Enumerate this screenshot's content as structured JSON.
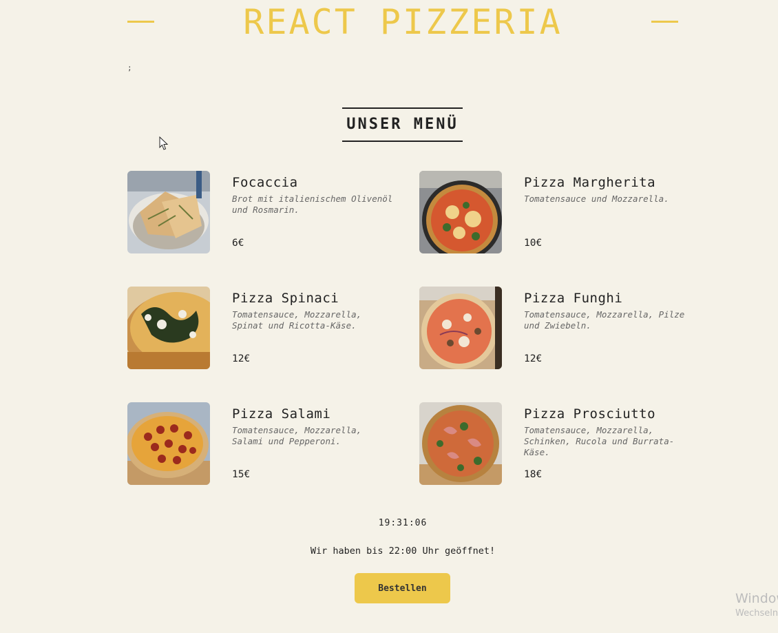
{
  "header": {
    "title": "REACT PIZZERIA"
  },
  "stray_text": ";",
  "menu": {
    "heading": "UNSER MENÜ",
    "items": [
      {
        "name": "Focaccia",
        "ingredients": "Brot mit italienischem Olivenöl und Rosmarin.",
        "price": "6€"
      },
      {
        "name": "Pizza Margherita",
        "ingredients": "Tomatensauce und Mozzarella.",
        "price": "10€"
      },
      {
        "name": "Pizza Spinaci",
        "ingredients": "Tomatensauce, Mozzarella, Spinat und Ricotta-Käse.",
        "price": "12€"
      },
      {
        "name": "Pizza Funghi",
        "ingredients": "Tomatensauce, Mozzarella, Pilze und Zwiebeln.",
        "price": "12€"
      },
      {
        "name": "Pizza Salami",
        "ingredients": "Tomatensauce, Mozzarella, Salami und Pepperoni.",
        "price": "15€"
      },
      {
        "name": "Pizza Prosciutto",
        "ingredients": "Tomatensauce, Mozzarella, Schinken, Rucola und Burrata-Käse.",
        "price": "18€"
      }
    ]
  },
  "footer": {
    "time": "19:31:06",
    "open_text": "Wir haben bis 22:00 Uhr geöffnet!",
    "order_label": "Bestellen"
  },
  "watermark": {
    "line1": "Windows",
    "line2": "Wechseln"
  },
  "colors": {
    "background": "#f5f2e8",
    "accent": "#edc84b",
    "text": "#222222"
  }
}
